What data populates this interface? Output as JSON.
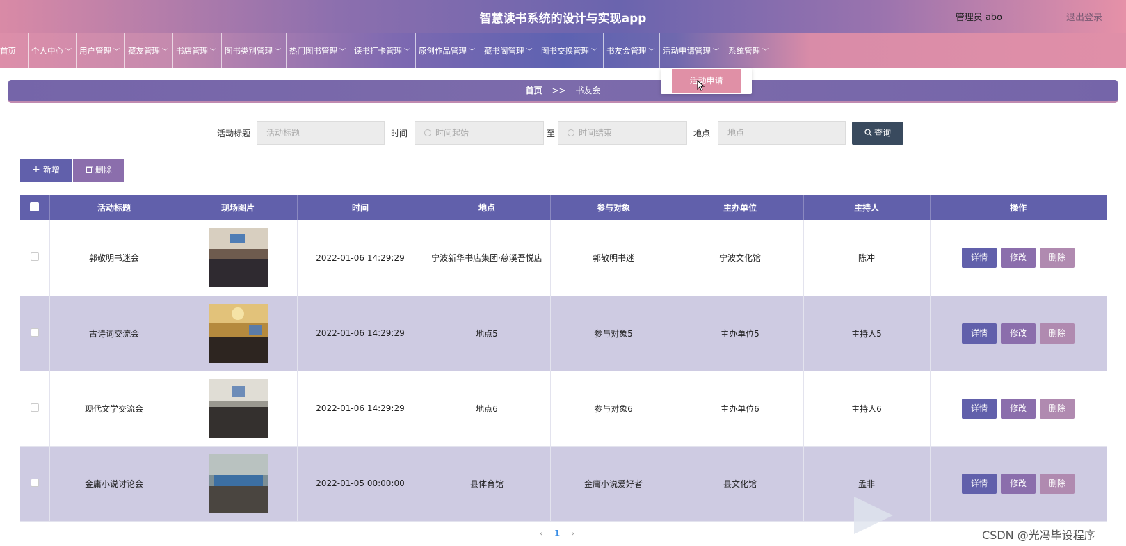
{
  "header": {
    "title": "智慧读书系统的设计与实现app",
    "user": "管理员 abo",
    "logout": "退出登录"
  },
  "nav": [
    {
      "label": "首页",
      "chev": false
    },
    {
      "label": "个人中心",
      "chev": true
    },
    {
      "label": "用户管理",
      "chev": true
    },
    {
      "label": "藏友管理",
      "chev": true
    },
    {
      "label": "书店管理",
      "chev": true
    },
    {
      "label": "图书类别管理",
      "chev": true
    },
    {
      "label": "热门图书管理",
      "chev": true
    },
    {
      "label": "读书打卡管理",
      "chev": true
    },
    {
      "label": "原创作品管理",
      "chev": true
    },
    {
      "label": "藏书阁管理",
      "chev": true
    },
    {
      "label": "图书交换管理",
      "chev": true
    },
    {
      "label": "书友会管理",
      "chev": true
    },
    {
      "label": "活动申请管理",
      "chev": true
    },
    {
      "label": "系统管理",
      "chev": true
    }
  ],
  "dropdown": {
    "item": "活动申请"
  },
  "breadcrumb": {
    "home": "首页",
    "sep": ">>",
    "current": "书友会"
  },
  "search": {
    "title_label": "活动标题",
    "title_placeholder": "活动标题",
    "time_label": "时间",
    "time_start": "时间起始",
    "to": "至",
    "time_end": "时间结束",
    "place_label": "地点",
    "place_placeholder": "地点",
    "query": "查询"
  },
  "actions": {
    "add": "新增",
    "delete": "删除"
  },
  "table": {
    "headers": [
      "活动标题",
      "现场图片",
      "时间",
      "地点",
      "参与对象",
      "主办单位",
      "主持人",
      "操作"
    ],
    "rows": [
      {
        "title": "郭敬明书迷会",
        "time": "2022-01-06 14:29:29",
        "place": "宁波新华书店集团·慈溪吾悦店",
        "target": "郭敬明书迷",
        "host": "宁波文化馆",
        "moderator": "陈冲"
      },
      {
        "title": "古诗词交流会",
        "time": "2022-01-06 14:29:29",
        "place": "地点5",
        "target": "参与对象5",
        "host": "主办单位5",
        "moderator": "主持人5"
      },
      {
        "title": "现代文学交流会",
        "time": "2022-01-06 14:29:29",
        "place": "地点6",
        "target": "参与对象6",
        "host": "主办单位6",
        "moderator": "主持人6"
      },
      {
        "title": "金庸小说讨论会",
        "time": "2022-01-05 00:00:00",
        "place": "县体育馆",
        "target": "金庸小说爱好者",
        "host": "县文化馆",
        "moderator": "孟非"
      }
    ],
    "ops": {
      "detail": "详情",
      "edit": "修改",
      "delete": "删除"
    }
  },
  "pager": {
    "page": "1",
    "prev": "‹",
    "next": "›"
  },
  "watermark": "CSDN @光冯毕设程序",
  "colors": {
    "primary": "#6160ab",
    "secondary": "#8b6eac",
    "tertiary": "#b08ab0",
    "alt_row": "#cecbe2",
    "query": "#394a5e"
  }
}
